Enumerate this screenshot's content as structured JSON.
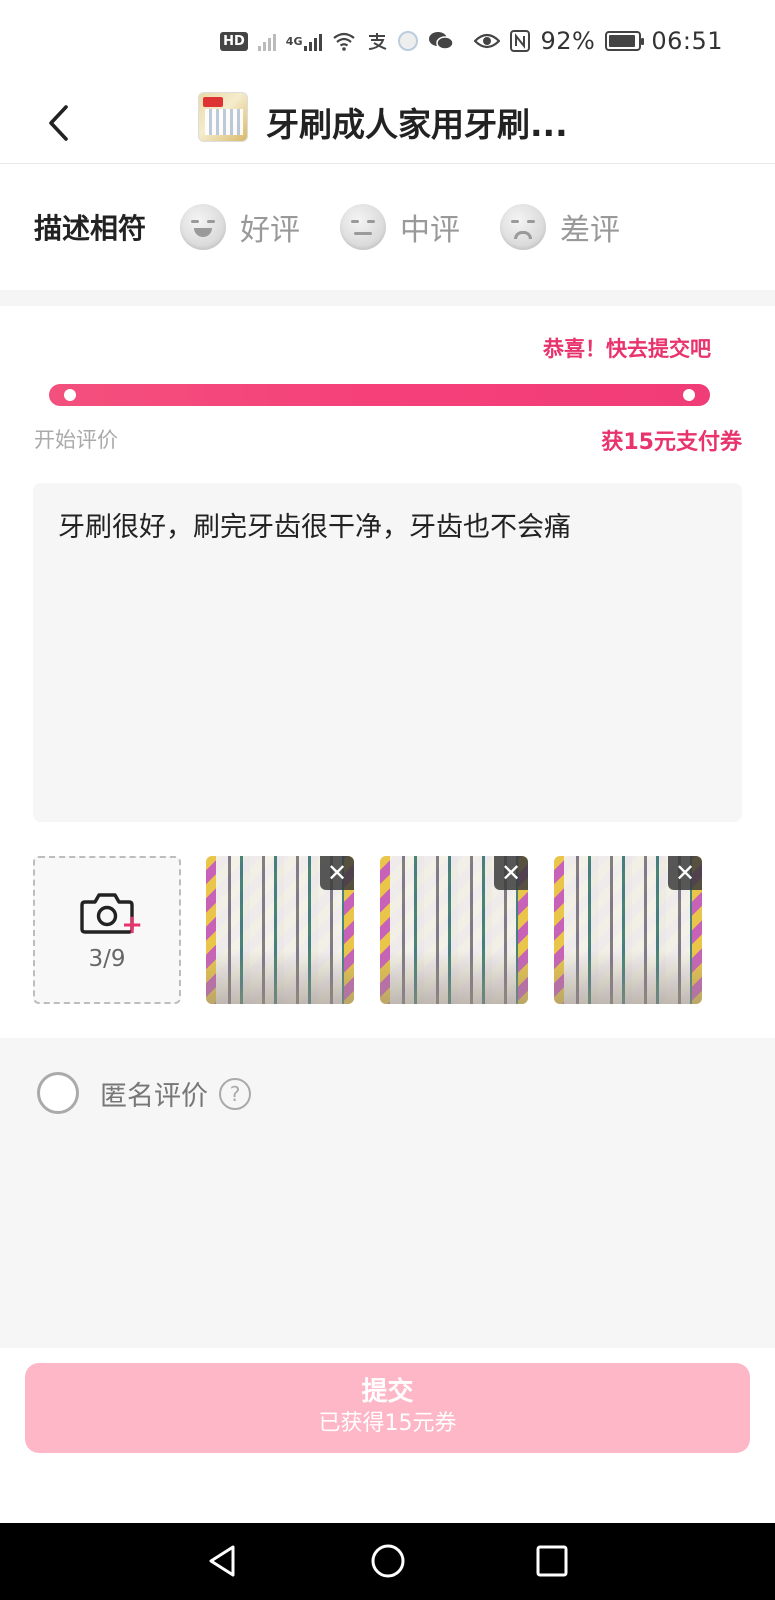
{
  "status_bar": {
    "hd_label": "HD",
    "network_label": "4G",
    "battery": "92%",
    "time": "06:51",
    "icons": [
      "hd-icon",
      "signal-icon",
      "signal-4g-icon",
      "wifi-icon",
      "alipay-icon",
      "app-icon",
      "wechat-icon",
      "eye-icon",
      "nfc-icon",
      "battery-icon"
    ]
  },
  "header": {
    "back_icon": "chevron-left-icon",
    "title": "牙刷成人家用牙刷..."
  },
  "rating": {
    "label": "描述相符",
    "options": [
      {
        "label": "好评",
        "icon": "happy-face-icon"
      },
      {
        "label": "中评",
        "icon": "neutral-face-icon"
      },
      {
        "label": "差评",
        "icon": "sad-face-icon"
      }
    ]
  },
  "progress": {
    "hint": "恭喜！快去提交吧",
    "start_label": "开始评价",
    "reward_label": "获15元支付券",
    "value_fraction": 1.0,
    "color": "#f5407a"
  },
  "review": {
    "text": "牙刷很好，刷完牙齿很干净，牙齿也不会痛"
  },
  "photos": {
    "count_label": "3/9",
    "add_icon": "camera-add-icon",
    "items": [
      {
        "name": "photo-1"
      },
      {
        "name": "photo-2"
      },
      {
        "name": "photo-3"
      }
    ],
    "close_glyph": "✕"
  },
  "anonymous": {
    "label": "匿名评价",
    "help_glyph": "?"
  },
  "submit": {
    "label": "提交",
    "sub_label": "已获得15元券",
    "color": "#feb7c6"
  },
  "nav": {
    "icons": [
      "nav-back-icon",
      "nav-home-icon",
      "nav-recent-icon"
    ]
  },
  "colors": {
    "accent": "#e8336d",
    "progress": "#f5407a"
  }
}
